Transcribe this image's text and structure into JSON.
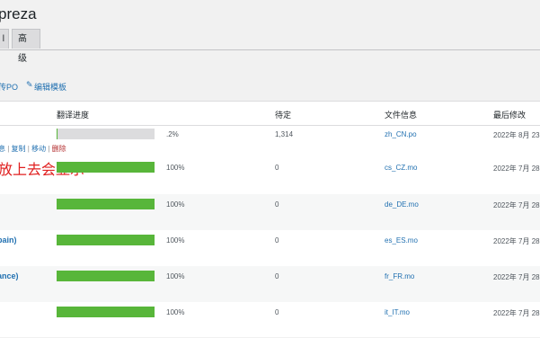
{
  "page": {
    "title": "preza"
  },
  "tabs": [
    "l",
    "高级"
  ],
  "actions": {
    "upload": "传PO",
    "edit_template": "编辑模板"
  },
  "table": {
    "headers": {
      "progress": "翻译进度",
      "pending": "待定",
      "file_info": "文件信息",
      "last_modified": "最后修改"
    },
    "rows": [
      {
        "lang": "",
        "progress": 0.002,
        "pct": ".2%",
        "pending": "1,314",
        "file": "zh_CN.po",
        "date": "2022年 8月 23"
      },
      {
        "lang": "",
        "progress": 1.0,
        "pct": "100%",
        "pending": "0",
        "file": "cs_CZ.mo",
        "date": "2022年 7月 28"
      },
      {
        "lang": "",
        "progress": 1.0,
        "pct": "100%",
        "pending": "0",
        "file": "de_DE.mo",
        "date": "2022年 7月 28"
      },
      {
        "lang": "pain)",
        "progress": 1.0,
        "pct": "100%",
        "pending": "0",
        "file": "es_ES.mo",
        "date": "2022年 7月 28"
      },
      {
        "lang": "ance)",
        "progress": 1.0,
        "pct": "100%",
        "pending": "0",
        "file": "fr_FR.mo",
        "date": "2022年 7月 28"
      },
      {
        "lang": "",
        "progress": 1.0,
        "pct": "100%",
        "pending": "0",
        "file": "it_IT.mo",
        "date": "2022年 7月 28"
      }
    ],
    "row_actions": {
      "info": "息",
      "copy": "复制",
      "move": "移动",
      "delete": "删除",
      "sep": "|"
    }
  },
  "annotation": "放上去会显示",
  "colors": {
    "progress_fill": "#58b63a",
    "link": "#2271b1",
    "delete": "#b32d2e",
    "annotation": "#e02020"
  }
}
